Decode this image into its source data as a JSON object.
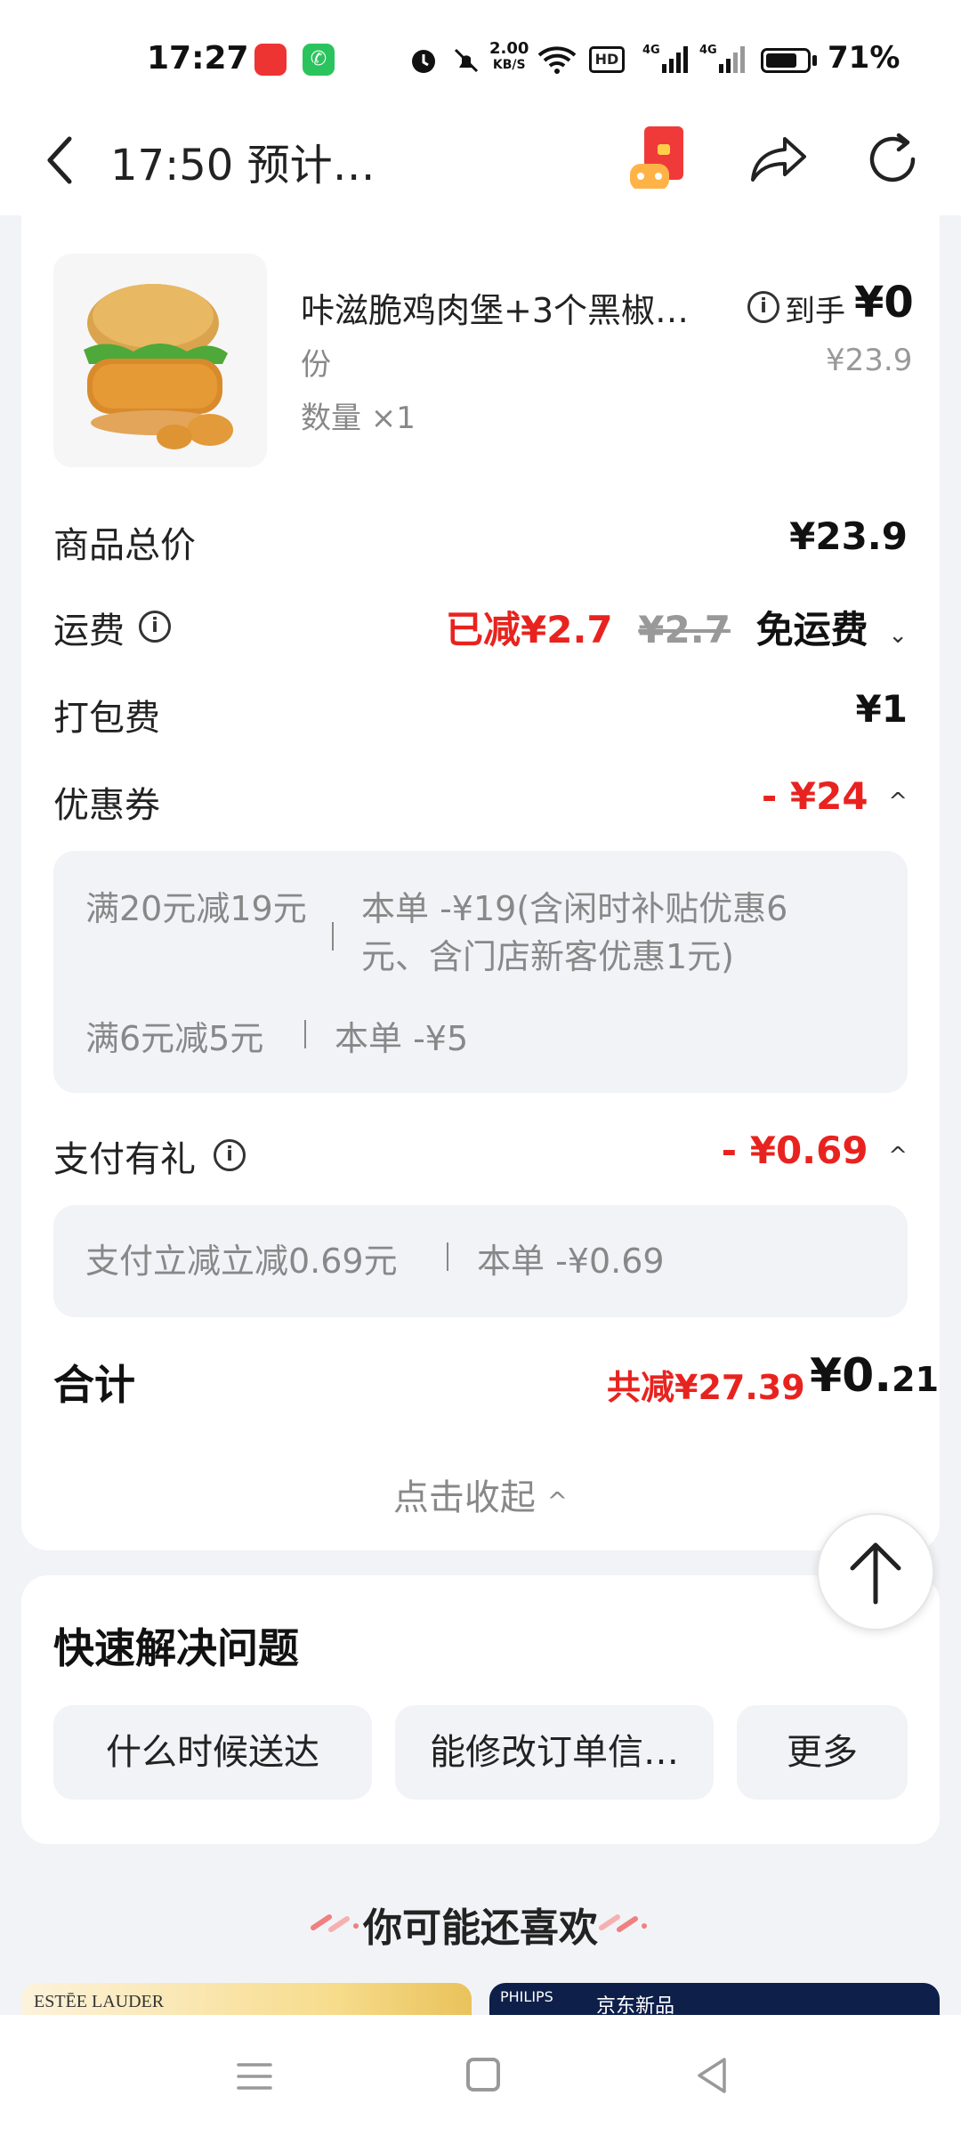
{
  "status_bar": {
    "time": "17:27",
    "net_speed_value": "2.00",
    "net_speed_unit": "KB/S",
    "battery": "71%",
    "icons": [
      "app-icon",
      "phone-app-icon",
      "alarm-icon",
      "mute-icon",
      "wifi-icon",
      "hd-icon",
      "signal-4g-icon",
      "signal-4g-icon",
      "battery-icon"
    ]
  },
  "header": {
    "title": "17:50 预计…",
    "icons": [
      "back-icon",
      "red-packet-game-icon",
      "share-icon",
      "refresh-icon"
    ]
  },
  "product": {
    "name": "咔滋脆鸡肉堡+3个黑椒…",
    "name_cont": "份",
    "quantity": "数量 ×1",
    "daoshou_label": "到手",
    "daoshou_price": "¥0",
    "original_price": "¥23.9"
  },
  "fees": {
    "subtotal_label": "商品总价",
    "subtotal": "¥23.9",
    "delivery_label": "运费",
    "delivery_reduced": "已减¥2.7",
    "delivery_original": "¥2.7",
    "delivery_free": "免运费",
    "packing_label": "打包费",
    "packing": "¥1",
    "coupon_label": "优惠券",
    "coupon_value": "- ¥24"
  },
  "coupons": [
    {
      "rule": "满20元减19元",
      "detail_line1": "本单 -¥19(含闲时补贴优惠6",
      "detail_line2": "元、含门店新客优惠1元)"
    },
    {
      "rule": "满6元减5元",
      "detail_line1": "本单 -¥5"
    }
  ],
  "payment_gift": {
    "label": "支付有礼",
    "value": "- ¥0.69",
    "rule": "支付立减立减0.69元",
    "detail": "本单 -¥0.69"
  },
  "total": {
    "label": "合计",
    "saved": "共减¥27.39",
    "price_main": "¥0.",
    "price_decimal": "21"
  },
  "collapse_label": "点击收起",
  "quick_solve": {
    "title": "快速解决问题",
    "chips": [
      "什么时候送达",
      "能修改订单信…",
      "更多"
    ]
  },
  "recommend_title": "你可能还喜欢",
  "banners": {
    "left_brand": "ESTĒE LAUDER",
    "right_brand": "PHILIPS",
    "right_text": "京东新品"
  },
  "colors": {
    "accent_red": "#e8231f",
    "page_bg": "#f2f3f7",
    "card_bg": "#ffffff"
  }
}
